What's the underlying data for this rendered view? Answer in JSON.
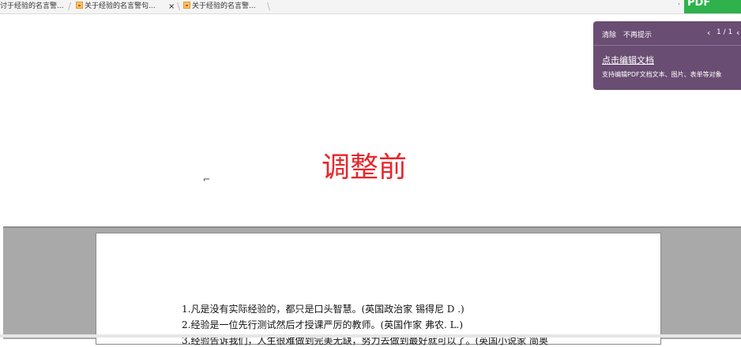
{
  "tabs": [
    {
      "label": "讨于经验的名言警..."
    },
    {
      "label": "关于经验的名言警句..."
    },
    {
      "label": "关于经验的名言警..."
    }
  ],
  "tab_close_glyph": "×",
  "brand_badge": {
    "text": "PDF"
  },
  "tip": {
    "clear_label": "清除",
    "no_more_label": "不再提示",
    "page_indicator": "1 / 1",
    "title": "点击编辑文档",
    "description": "支持编辑PDF文档文本、图片、表单等对象"
  },
  "main_label": "调整前",
  "document": {
    "lines": [
      "1.凡是没有实际经验的，都只是口头智慧。(英国政治家  锡得尼  D .)",
      "2.经验是一位先行测试然后才授课严厉的教师。(英国作家  弗农. L.)",
      "3.经验告诉我们，人生很难做到完美无缺，努力去做到最好就可以了。(英国小说家  简奥"
    ]
  },
  "colors": {
    "accent_red": "#e8262b",
    "tip_purple": "#6a4d73",
    "badge_green": "#2fb24b",
    "viewer_gray": "#a9a9a9"
  },
  "icons": [
    "document-tab-icon",
    "close-icon",
    "chevron-left-icon",
    "chevron-right-icon"
  ]
}
